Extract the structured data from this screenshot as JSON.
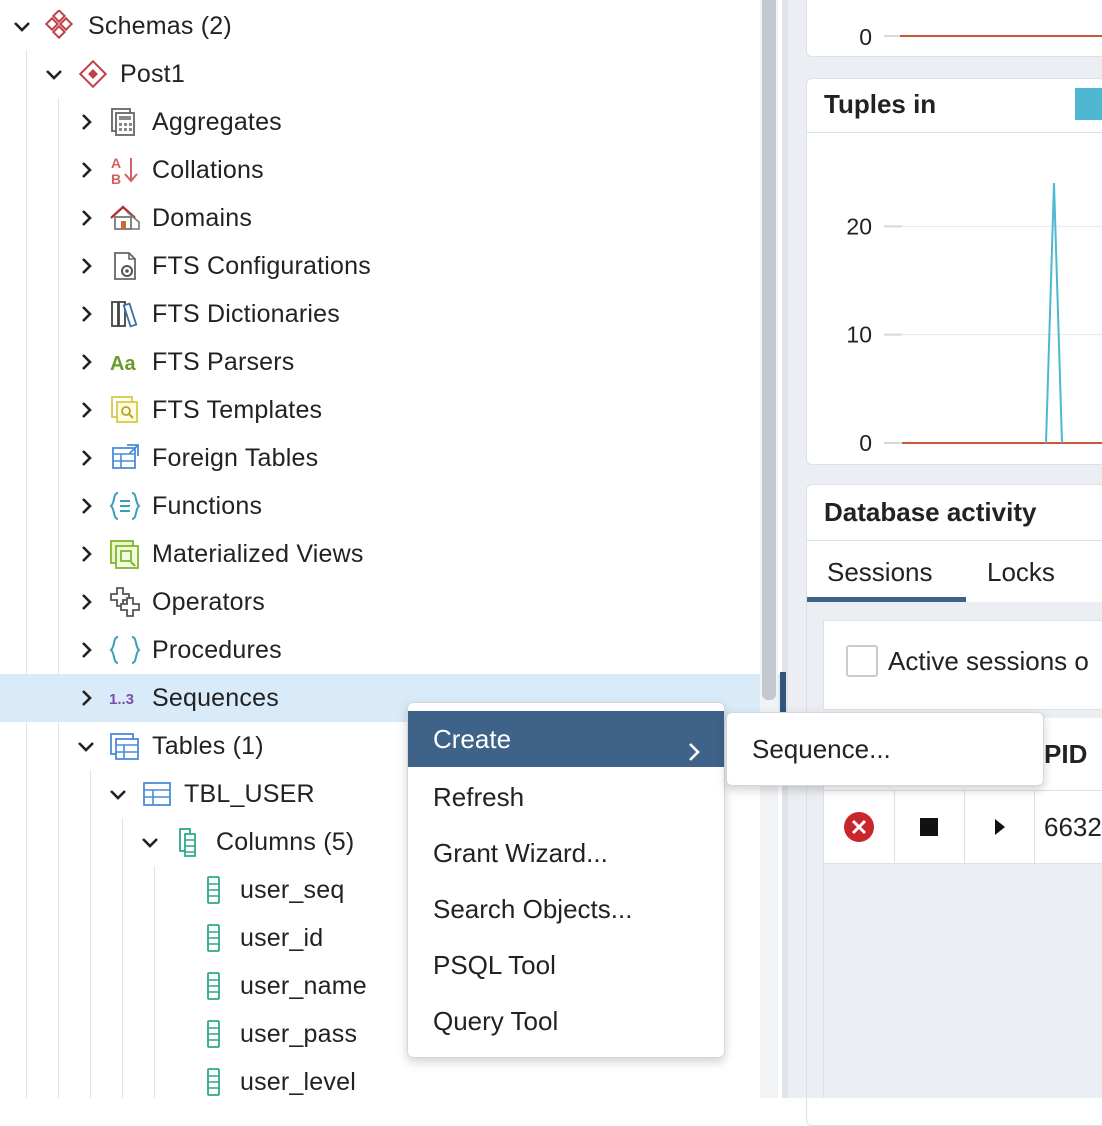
{
  "tree": {
    "schemas_label": "Schemas (2)",
    "schema_name": "Post1",
    "nodes": {
      "aggregates": "Aggregates",
      "collations": "Collations",
      "domains": "Domains",
      "fts_configurations": "FTS Configurations",
      "fts_dictionaries": "FTS Dictionaries",
      "fts_parsers": "FTS Parsers",
      "fts_templates": "FTS Templates",
      "foreign_tables": "Foreign Tables",
      "functions": "Functions",
      "materialized_views": "Materialized Views",
      "operators": "Operators",
      "procedures": "Procedures",
      "sequences": "Sequences",
      "tables": "Tables (1)"
    },
    "table_name": "TBL_USER",
    "columns_label": "Columns (5)",
    "columns": [
      "user_seq",
      "user_id",
      "user_name",
      "user_pass",
      "user_level"
    ],
    "icon_glyphs": {
      "collations_a": "A",
      "collations_b": "B",
      "fts_parsers": "Aa",
      "sequences": "1..3"
    },
    "selected_node": "Sequences"
  },
  "context_menu": {
    "items": [
      "Create",
      "Refresh",
      "Grant Wizard...",
      "Search Objects...",
      "PSQL Tool",
      "Query Tool"
    ],
    "active_item": "Create",
    "submenu_items": [
      "Sequence..."
    ]
  },
  "dashboard": {
    "top_chart": {
      "y_tick": "0"
    },
    "tuples_in": {
      "title": "Tuples in",
      "y_ticks": [
        "20",
        "10",
        "0"
      ],
      "ylim": [
        0,
        24
      ],
      "series_colors": [
        "#4fb8d0",
        "#c8583a"
      ]
    },
    "database_activity": {
      "title": "Database activity",
      "tabs": [
        "Sessions",
        "Locks"
      ],
      "active_tab": "Sessions",
      "active_sessions_label": "Active sessions o",
      "column_header": "PID",
      "row_pid": "6632"
    }
  },
  "chart_data": {
    "type": "line",
    "title": "Tuples in",
    "xlabel": "",
    "ylabel": "",
    "ylim": [
      0,
      24
    ],
    "y_ticks": [
      0,
      10,
      20
    ],
    "x": [
      0,
      1,
      2,
      3,
      4,
      5,
      6,
      7,
      8,
      9,
      10,
      11,
      12,
      13,
      14
    ],
    "series": [
      {
        "values": [
          0,
          0,
          0,
          0,
          0,
          0,
          0,
          0,
          0,
          24,
          0,
          0,
          0,
          0,
          0
        ],
        "color": "#4fb8d0"
      },
      {
        "values": [
          0,
          0,
          0,
          0,
          0,
          0,
          0,
          0,
          0,
          0,
          0,
          0,
          0,
          0,
          0
        ],
        "color": "#c8583a"
      }
    ]
  }
}
